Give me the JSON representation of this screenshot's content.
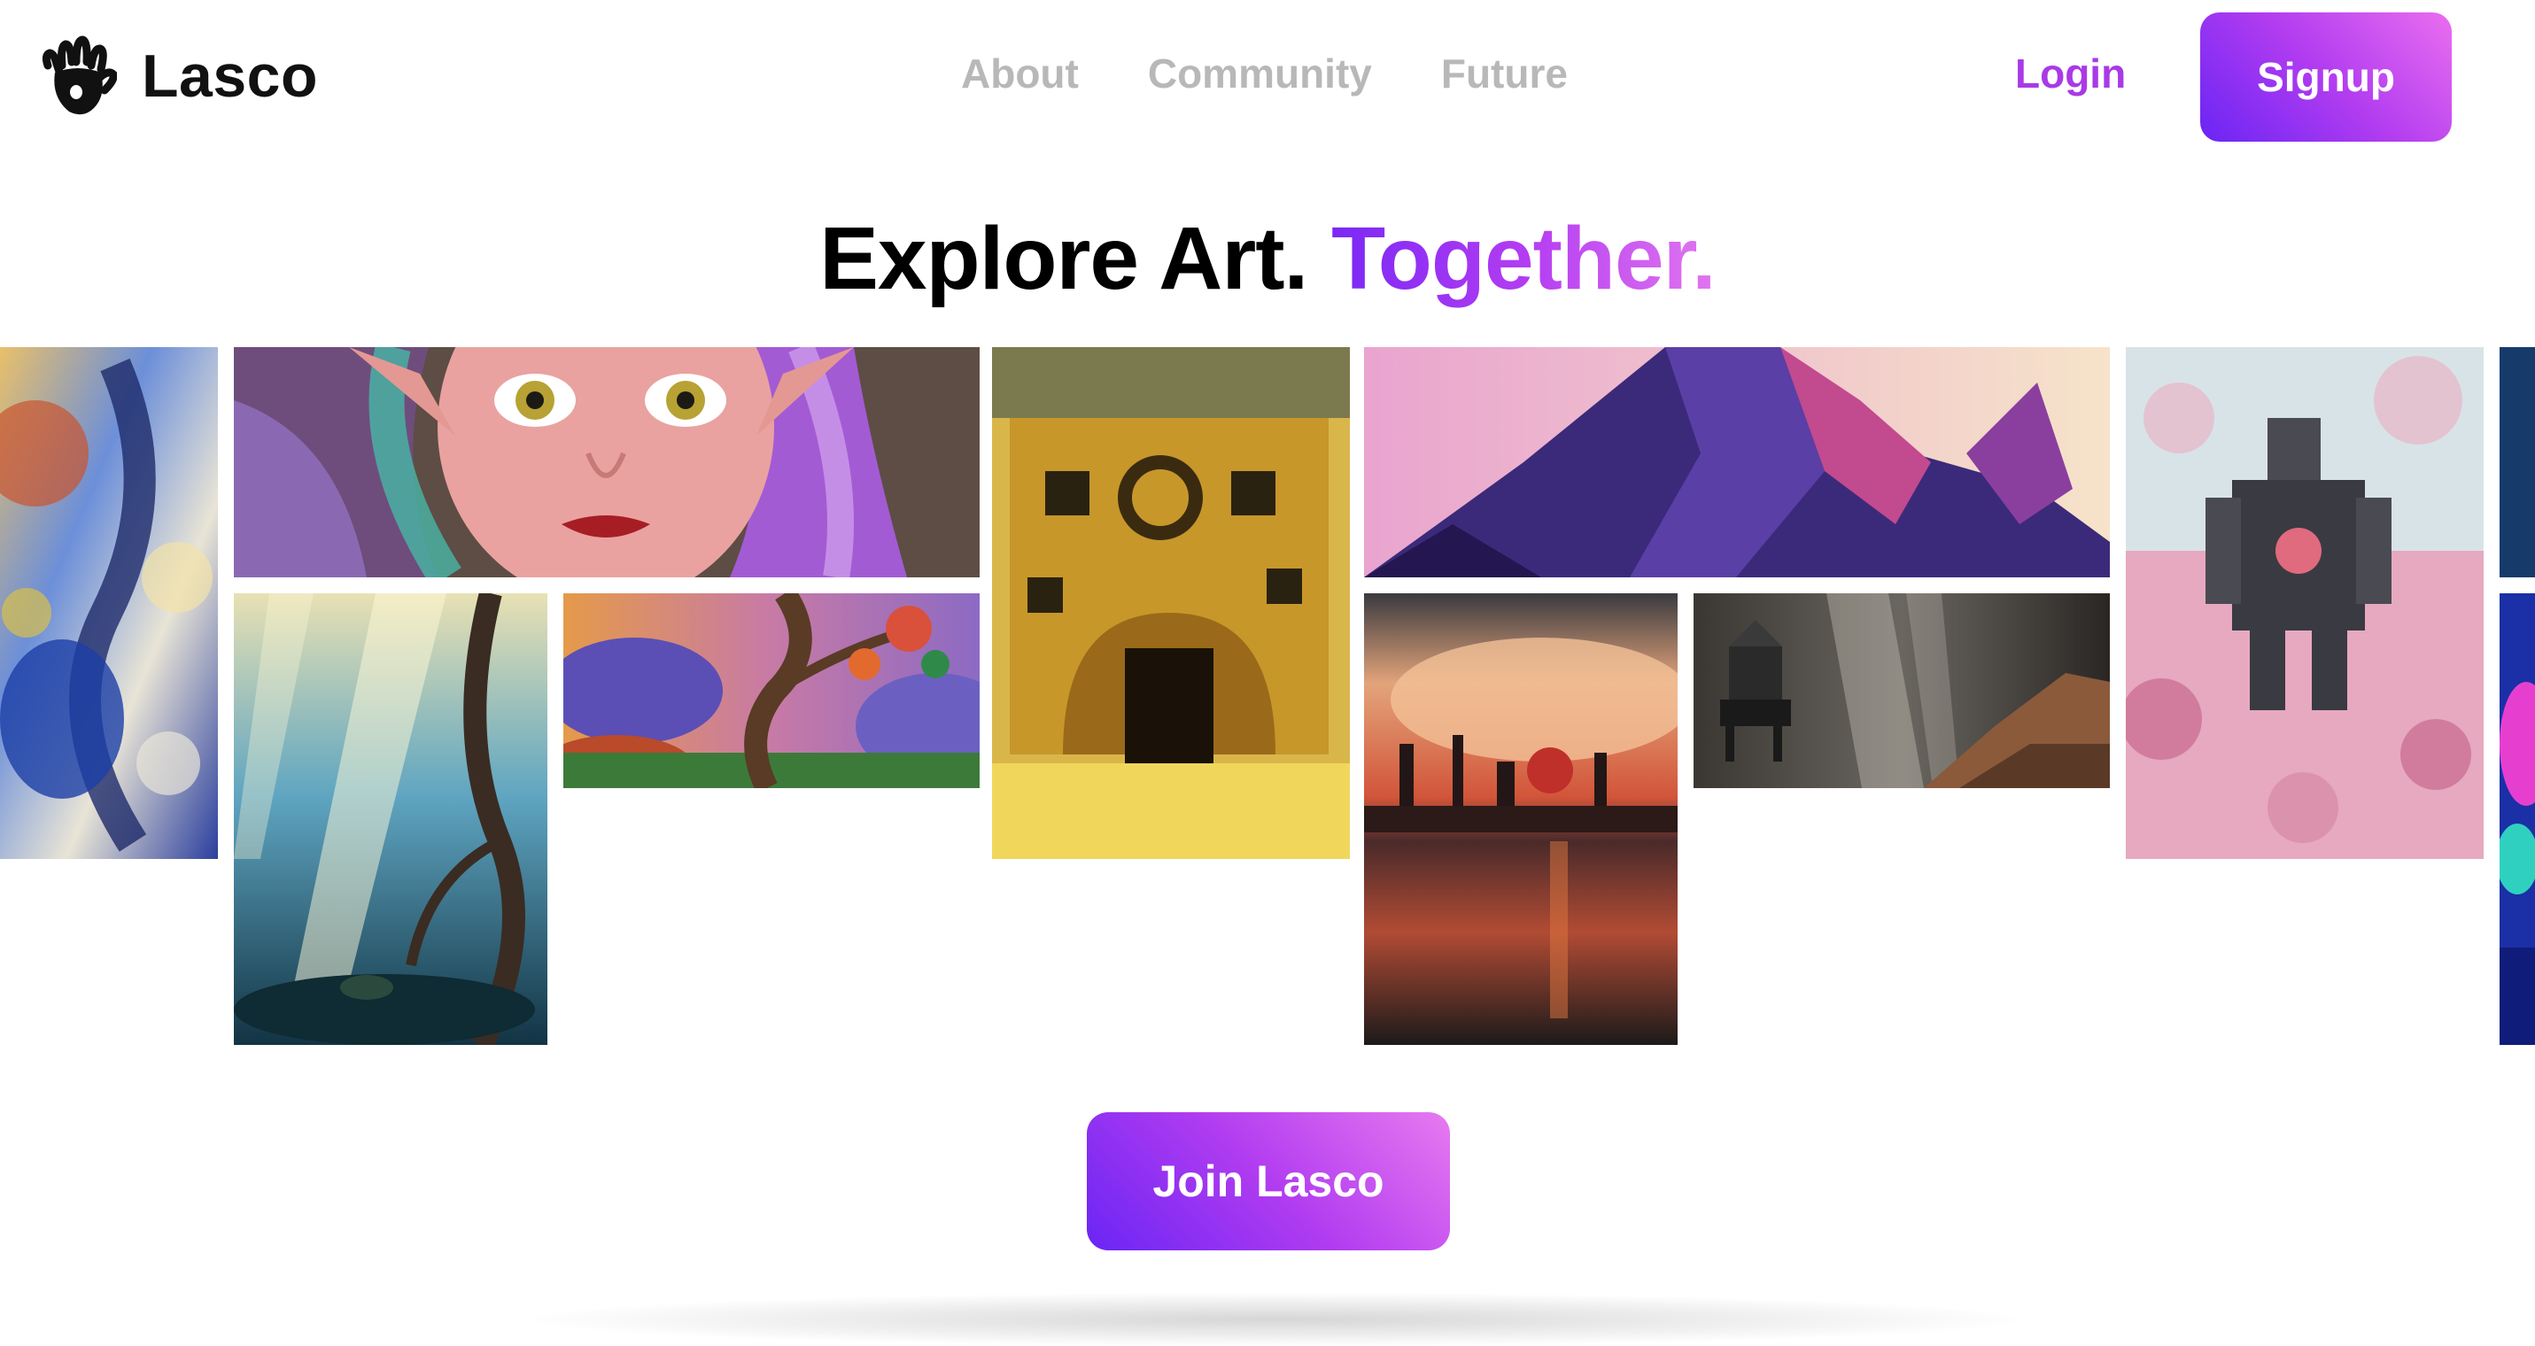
{
  "brand": {
    "name": "Lasco",
    "logo_icon": "handprint-icon"
  },
  "nav": {
    "links": [
      "About",
      "Community",
      "Future"
    ]
  },
  "auth": {
    "login_label": "Login",
    "signup_label": "Signup"
  },
  "hero": {
    "headline_main": "Explore Art.",
    "headline_accent": "Together."
  },
  "gallery": {
    "artworks": [
      "abstract-swirl-painting",
      "elf-girl-portrait",
      "enchanted-forest-light",
      "twisted-tree-sunset",
      "golden-gear-temple",
      "purple-mountain-peak",
      "burning-city-reflection",
      "lone-robot-canyon",
      "knight-in-flower-field",
      "neon-creature-partial"
    ]
  },
  "cta": {
    "join_label": "Join Lasco"
  },
  "colors": {
    "accent_start": "#6a25f4",
    "accent_mid": "#b13cf0",
    "accent_end": "#ea6ef0",
    "nav_text": "#b8b8b8",
    "login_text": "#a93ae6",
    "headline_text": "#000000"
  }
}
